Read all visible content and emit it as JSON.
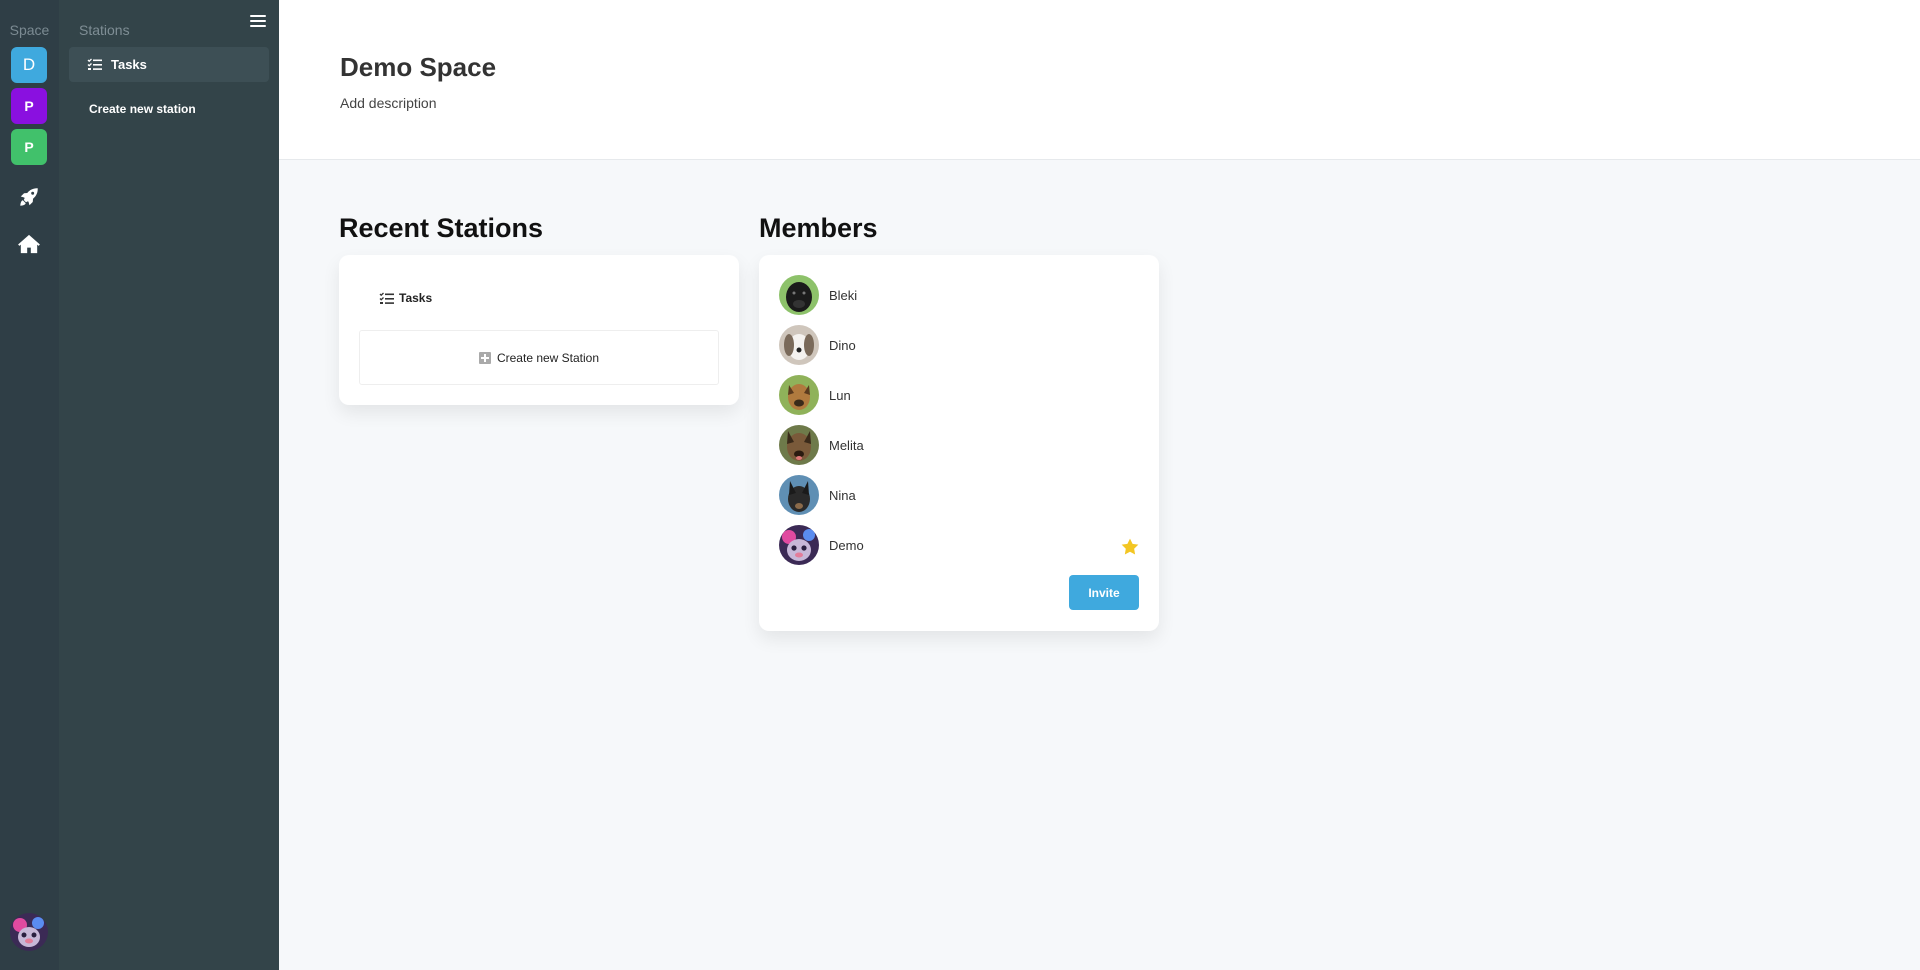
{
  "rail": {
    "title": "Space",
    "spaces": [
      {
        "label": "D",
        "color": "#3fa9de"
      },
      {
        "label": "P",
        "color": "#8a10e0"
      },
      {
        "label": "P",
        "color": "#41c16b"
      }
    ],
    "icons": [
      "rocket-icon",
      "home-icon"
    ]
  },
  "panel": {
    "title": "Stations",
    "station": "Tasks",
    "create_link": "Create new station"
  },
  "header": {
    "title": "Demo Space",
    "description": "Add description"
  },
  "recent": {
    "title": "Recent Stations",
    "station": "Tasks",
    "create_button": "Create new Station"
  },
  "members": {
    "title": "Members",
    "list": [
      {
        "name": "Bleki"
      },
      {
        "name": "Dino"
      },
      {
        "name": "Lun"
      },
      {
        "name": "Melita"
      },
      {
        "name": "Nina"
      },
      {
        "name": "Demo",
        "starred": true
      }
    ],
    "invite_label": "Invite"
  },
  "colors": {
    "accent": "#3fa9de",
    "rail_bg": "#2f3e46",
    "panel_bg": "#334449",
    "star": "#f3c623"
  }
}
